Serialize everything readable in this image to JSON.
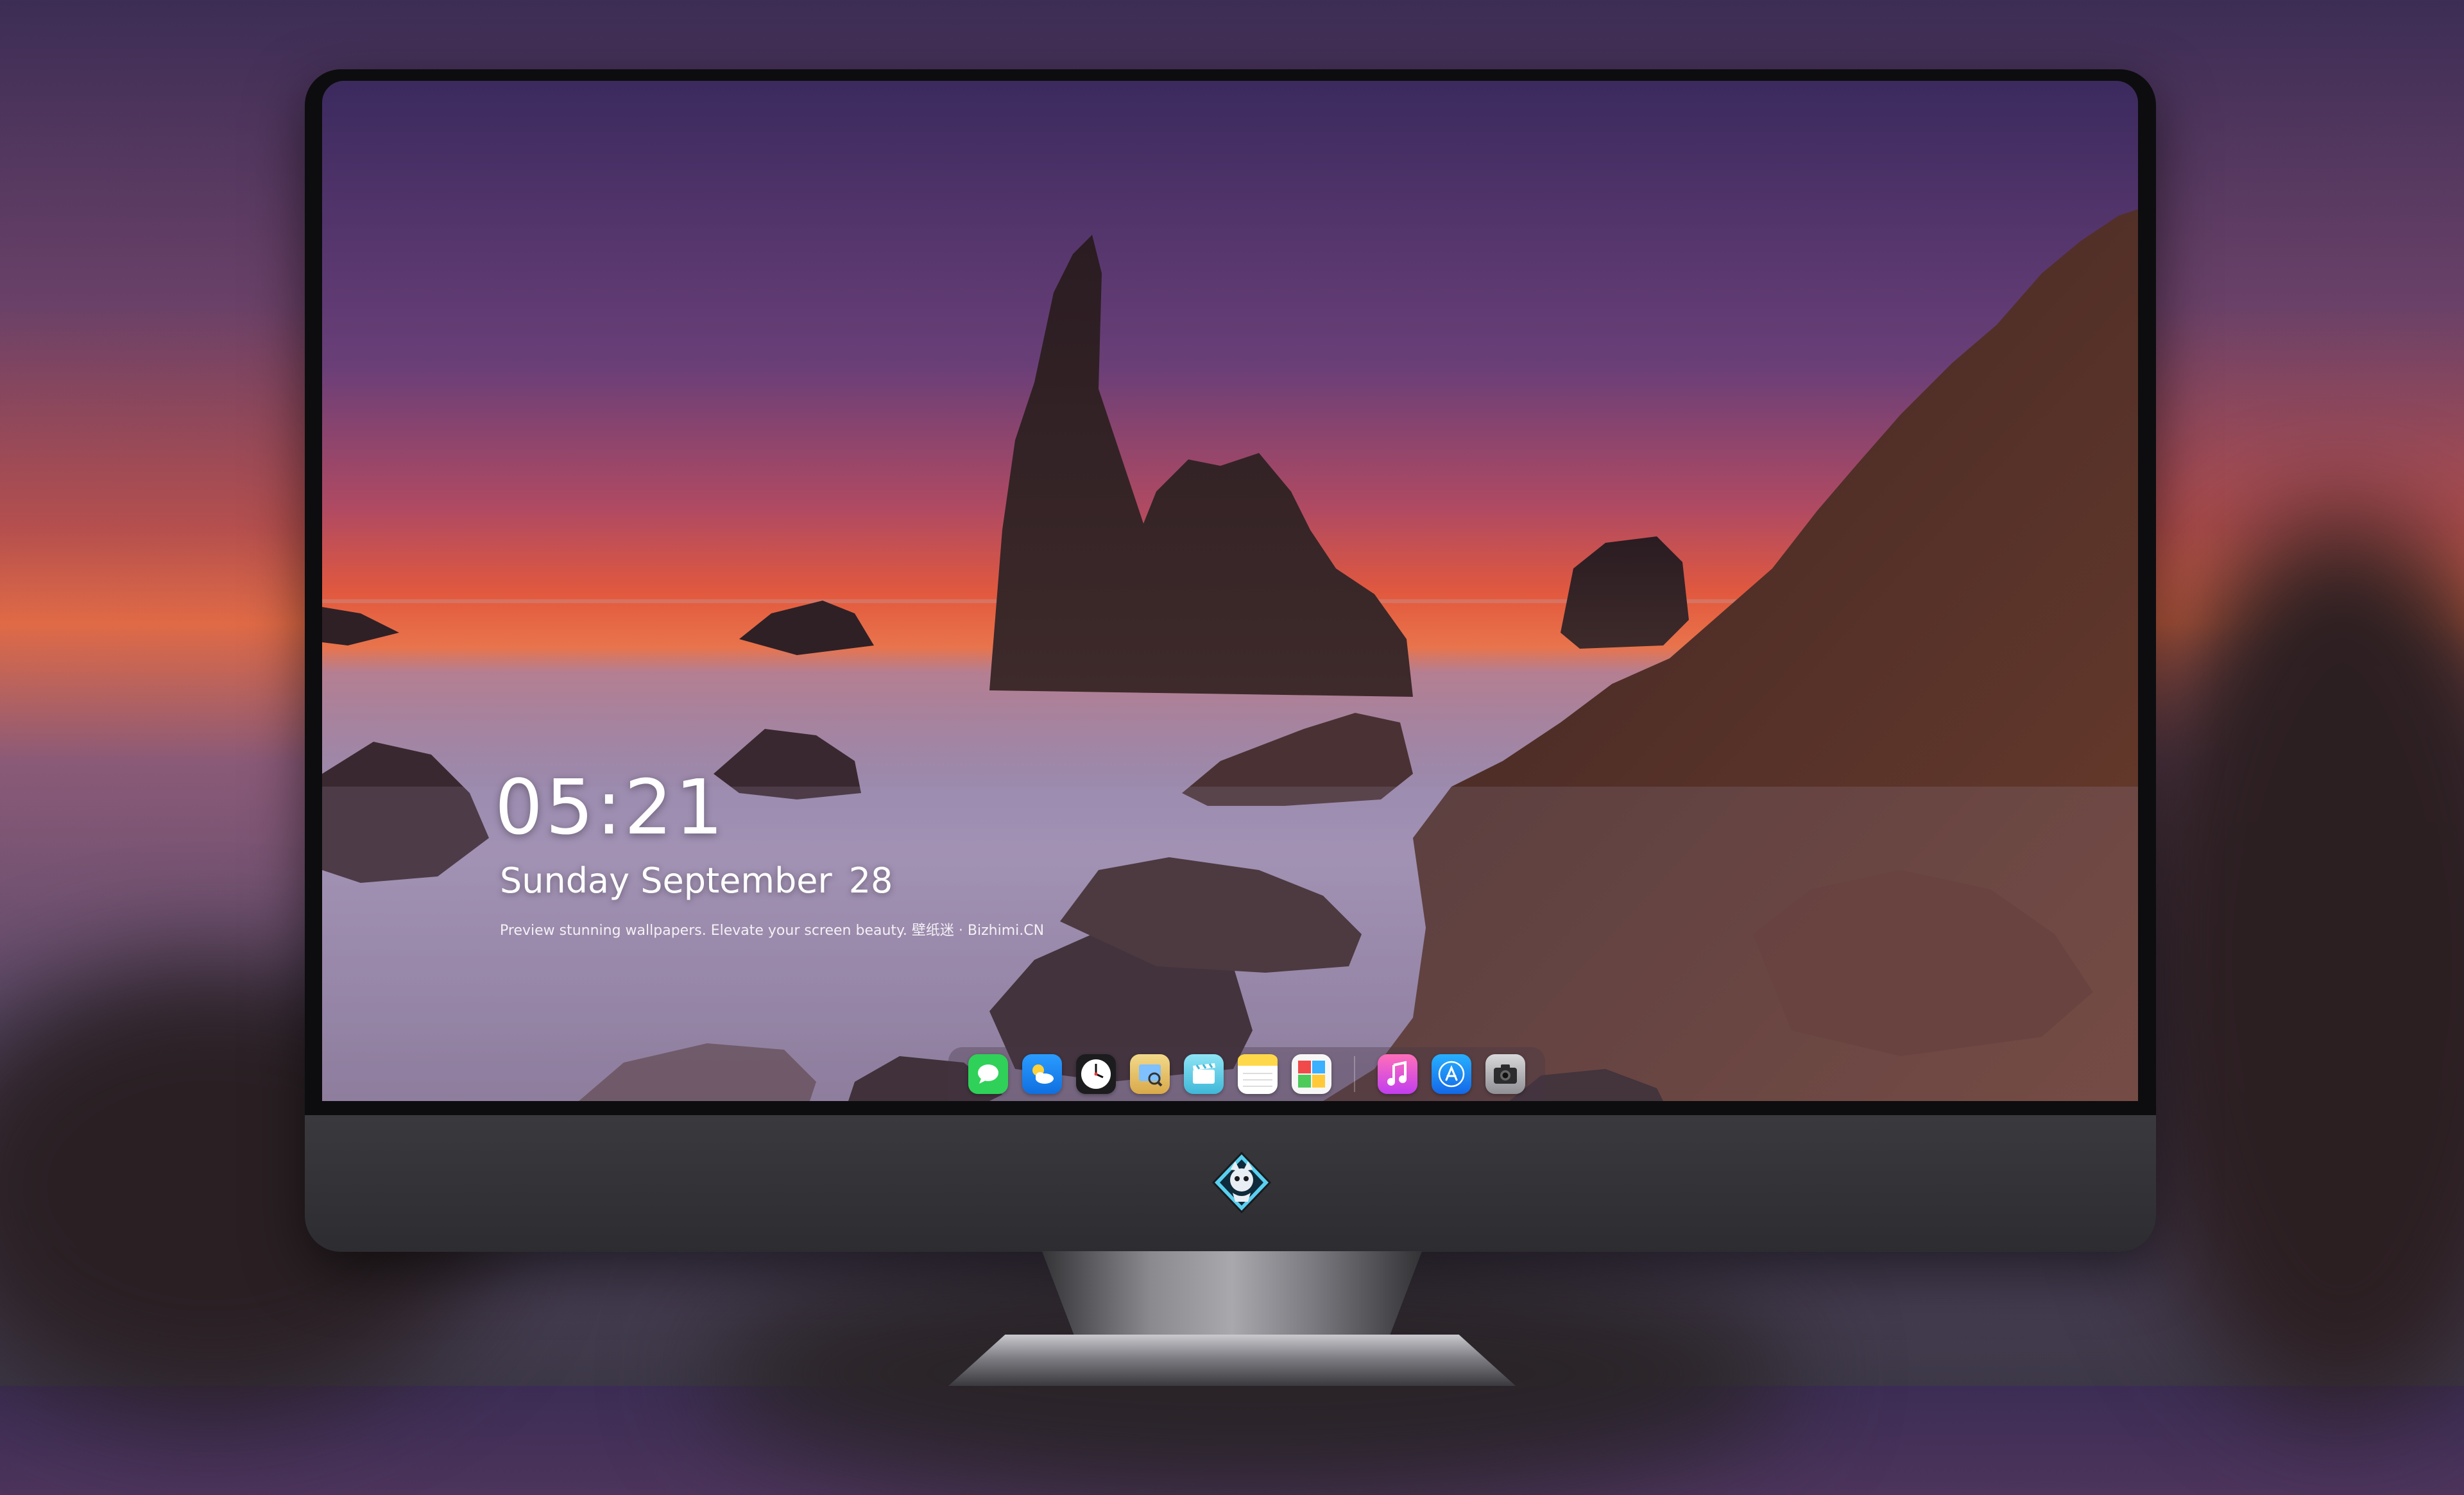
{
  "lockscreen": {
    "time": "05:21",
    "date_text": "Sunday September",
    "day_number": "28",
    "tagline": "Preview stunning wallpapers. Elevate your screen beauty. 壁纸迷 · Bizhimi.CN"
  },
  "dock": {
    "apps": [
      {
        "name": "Messages",
        "icon": "messages-icon",
        "color": "#2fd158"
      },
      {
        "name": "Weather",
        "icon": "weather-icon",
        "color": "#1f8bff"
      },
      {
        "name": "Clock",
        "icon": "clock-icon",
        "color": "#1c1c1e"
      },
      {
        "name": "Preview",
        "icon": "preview-icon",
        "color": "#e9c86a"
      },
      {
        "name": "Clips",
        "icon": "clips-icon",
        "color": "#6fd3ee"
      },
      {
        "name": "Notes",
        "icon": "notes-icon",
        "color": "#ffd84a"
      },
      {
        "name": "Photo Booth",
        "icon": "photo-booth-icon",
        "color": "#f04a4a"
      },
      {
        "name": "Music",
        "icon": "music-icon",
        "color": "#ff4fa3"
      },
      {
        "name": "App Store",
        "icon": "app-store-icon",
        "color": "#1c8cff"
      },
      {
        "name": "Camera",
        "icon": "camera-icon",
        "color": "#3a3a3c"
      }
    ]
  },
  "hardware": {
    "logo": "shield-mascot-logo"
  },
  "colors": {
    "sky_top": "#3b2a5e",
    "horizon": "#f07040",
    "mist": "#8a7aa0",
    "rock": "#2a1c22"
  }
}
